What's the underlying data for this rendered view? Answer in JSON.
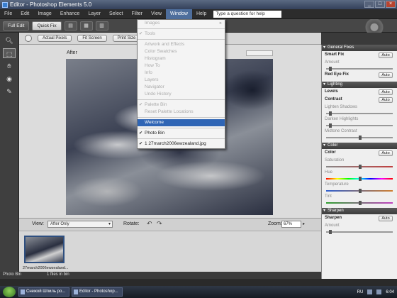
{
  "window": {
    "title": "Editor - Photoshop Elements 5.0",
    "controls": [
      "_",
      "□",
      "×"
    ]
  },
  "menu": {
    "items": [
      "File",
      "Edit",
      "Image",
      "Enhance",
      "Layer",
      "Select",
      "Filter",
      "View",
      "Window",
      "Help"
    ],
    "active": "Window",
    "help_placeholder": "Type a question for help"
  },
  "modes": {
    "full": "Full Edit",
    "quick": "Quick Fix"
  },
  "options": {
    "actual_pixels": "Actual Pixels",
    "fit_screen": "Fit Screen",
    "print_size": "Print Size"
  },
  "workspace": {
    "after_label": "After"
  },
  "viewbar": {
    "view_label": "View:",
    "view_value": "After Only",
    "rotate_label": "Rotate:",
    "zoom_label": "Zoom:",
    "zoom_value": "67%"
  },
  "bin": {
    "thumb_name": "27march2006ewzealand..."
  },
  "binbar": {
    "label": "Photo Bin",
    "bin_option": "1 files in bin"
  },
  "window_menu": {
    "items": [
      {
        "label": "Images",
        "enabled": false,
        "submenu": true
      },
      {
        "label": "Tools",
        "enabled": false,
        "checked": true
      },
      {
        "label": "Artwork and Effects",
        "enabled": false
      },
      {
        "label": "Color Swatches",
        "enabled": false
      },
      {
        "label": "Histogram",
        "enabled": false
      },
      {
        "label": "How To",
        "enabled": false
      },
      {
        "label": "Info",
        "enabled": false
      },
      {
        "label": "Layers",
        "enabled": false
      },
      {
        "label": "Navigator",
        "enabled": false
      },
      {
        "label": "Undo History",
        "enabled": false
      },
      {
        "label": "Palette Bin",
        "enabled": false,
        "checked": true
      },
      {
        "label": "Reset Palette Locations",
        "enabled": false
      },
      {
        "label": "Welcome",
        "enabled": true,
        "highlight": true
      },
      {
        "label": "Photo Bin",
        "enabled": true,
        "checked": true
      },
      {
        "label": "1 27march2006ewzealand.jpg",
        "enabled": true,
        "checked": true
      }
    ]
  },
  "panel": {
    "general_fixes": "General Fixes",
    "smart_fix": "Smart Fix",
    "amount": "Amount",
    "red_eye": "Red Eye Fix",
    "lighting": "Lighting",
    "levels": "Levels",
    "contrast": "Contrast",
    "lighten_shadows": "Lighten Shadows",
    "darken_highlights": "Darken Highlights",
    "midtone_contrast": "Midtone Contrast",
    "color": "Color",
    "color_row": "Color",
    "saturation": "Saturation",
    "hue": "Hue",
    "temperature": "Temperature",
    "tint": "Tint",
    "sharpen": "Sharpen",
    "sharpen_row": "Sharpen",
    "auto": "Auto"
  },
  "taskbar": {
    "items": [
      "Снежой Шпиль ро...",
      "Editor - Photoshop..."
    ],
    "lang": "RU",
    "time": "6:04"
  }
}
